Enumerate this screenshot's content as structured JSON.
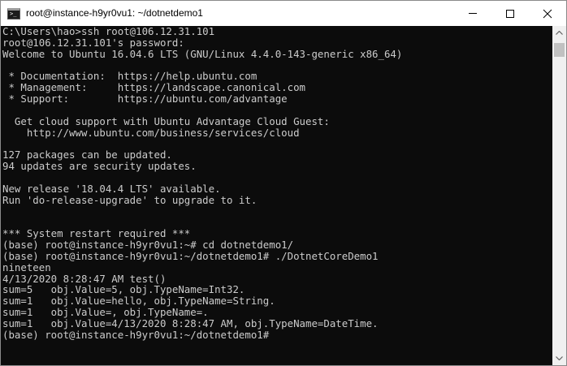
{
  "window": {
    "title": "root@instance-h9yr0vu1: ~/dotnetdemo1",
    "icon": "terminal-icon",
    "controls": [
      "minimize-icon",
      "maximize-icon",
      "close-icon"
    ]
  },
  "terminal": {
    "text_color": "#cccccc",
    "background_color": "#0c0c0c",
    "lines": [
      "C:\\Users\\hao>ssh root@106.12.31.101",
      "root@106.12.31.101's password:",
      "Welcome to Ubuntu 16.04.6 LTS (GNU/Linux 4.4.0-143-generic x86_64)",
      "",
      " * Documentation:  https://help.ubuntu.com",
      " * Management:     https://landscape.canonical.com",
      " * Support:        https://ubuntu.com/advantage",
      "",
      "  Get cloud support with Ubuntu Advantage Cloud Guest:",
      "    http://www.ubuntu.com/business/services/cloud",
      "",
      "127 packages can be updated.",
      "94 updates are security updates.",
      "",
      "New release '18.04.4 LTS' available.",
      "Run 'do-release-upgrade' to upgrade to it.",
      "",
      "",
      "*** System restart required ***",
      "(base) root@instance-h9yr0vu1:~# cd dotnetdemo1/",
      "(base) root@instance-h9yr0vu1:~/dotnetdemo1# ./DotnetCoreDemo1",
      "nineteen",
      "4/13/2020 8:28:47 AM test()",
      "sum=5   obj.Value=5, obj.TypeName=Int32.",
      "sum=1   obj.Value=hello, obj.TypeName=String.",
      "sum=1   obj.Value=, obj.TypeName=.",
      "sum=1   obj.Value=4/13/2020 8:28:47 AM, obj.TypeName=DateTime.",
      "(base) root@instance-h9yr0vu1:~/dotnetdemo1# "
    ]
  }
}
